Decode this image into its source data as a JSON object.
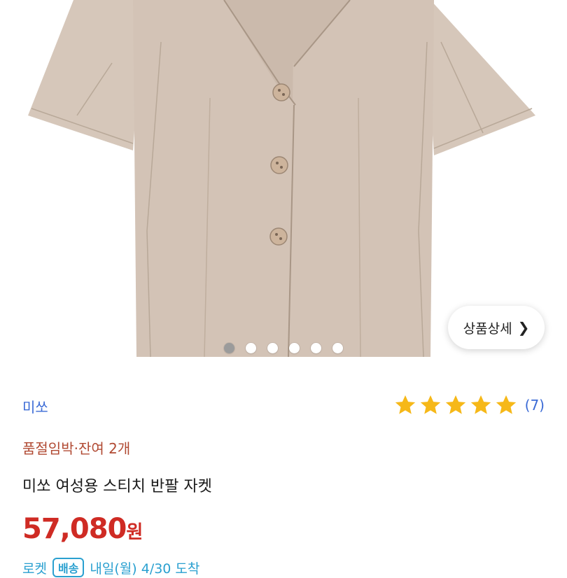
{
  "image": {
    "description_icon": "jacket-image",
    "dots_count": 6,
    "active_dot": 1
  },
  "detail_button": {
    "label": "상품상세",
    "icon": "chevron-right-icon"
  },
  "seller": {
    "name": "미쏘"
  },
  "rating": {
    "stars": 5,
    "count_label": "(7)",
    "star_color": "#f6b818"
  },
  "stock": {
    "label": "품절임박·잔여 2개"
  },
  "product": {
    "title": "미쏘 여성용 스티치 반팔 자켓"
  },
  "price": {
    "value": "57,080",
    "unit": "원",
    "color": "#cf2b24"
  },
  "delivery": {
    "brand": "로켓",
    "badge": "배송",
    "date_label": "내일(월) 4/30 도착"
  }
}
